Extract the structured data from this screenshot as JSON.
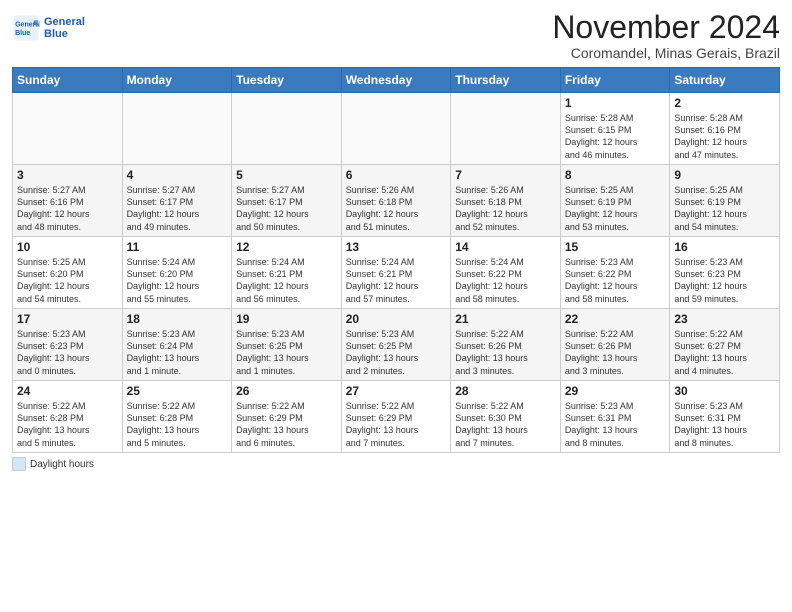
{
  "header": {
    "logo_line1": "General",
    "logo_line2": "Blue",
    "month": "November 2024",
    "location": "Coromandel, Minas Gerais, Brazil"
  },
  "weekdays": [
    "Sunday",
    "Monday",
    "Tuesday",
    "Wednesday",
    "Thursday",
    "Friday",
    "Saturday"
  ],
  "weeks": [
    [
      {
        "day": "",
        "info": ""
      },
      {
        "day": "",
        "info": ""
      },
      {
        "day": "",
        "info": ""
      },
      {
        "day": "",
        "info": ""
      },
      {
        "day": "",
        "info": ""
      },
      {
        "day": "1",
        "info": "Sunrise: 5:28 AM\nSunset: 6:15 PM\nDaylight: 12 hours\nand 46 minutes."
      },
      {
        "day": "2",
        "info": "Sunrise: 5:28 AM\nSunset: 6:16 PM\nDaylight: 12 hours\nand 47 minutes."
      }
    ],
    [
      {
        "day": "3",
        "info": "Sunrise: 5:27 AM\nSunset: 6:16 PM\nDaylight: 12 hours\nand 48 minutes."
      },
      {
        "day": "4",
        "info": "Sunrise: 5:27 AM\nSunset: 6:17 PM\nDaylight: 12 hours\nand 49 minutes."
      },
      {
        "day": "5",
        "info": "Sunrise: 5:27 AM\nSunset: 6:17 PM\nDaylight: 12 hours\nand 50 minutes."
      },
      {
        "day": "6",
        "info": "Sunrise: 5:26 AM\nSunset: 6:18 PM\nDaylight: 12 hours\nand 51 minutes."
      },
      {
        "day": "7",
        "info": "Sunrise: 5:26 AM\nSunset: 6:18 PM\nDaylight: 12 hours\nand 52 minutes."
      },
      {
        "day": "8",
        "info": "Sunrise: 5:25 AM\nSunset: 6:19 PM\nDaylight: 12 hours\nand 53 minutes."
      },
      {
        "day": "9",
        "info": "Sunrise: 5:25 AM\nSunset: 6:19 PM\nDaylight: 12 hours\nand 54 minutes."
      }
    ],
    [
      {
        "day": "10",
        "info": "Sunrise: 5:25 AM\nSunset: 6:20 PM\nDaylight: 12 hours\nand 54 minutes."
      },
      {
        "day": "11",
        "info": "Sunrise: 5:24 AM\nSunset: 6:20 PM\nDaylight: 12 hours\nand 55 minutes."
      },
      {
        "day": "12",
        "info": "Sunrise: 5:24 AM\nSunset: 6:21 PM\nDaylight: 12 hours\nand 56 minutes."
      },
      {
        "day": "13",
        "info": "Sunrise: 5:24 AM\nSunset: 6:21 PM\nDaylight: 12 hours\nand 57 minutes."
      },
      {
        "day": "14",
        "info": "Sunrise: 5:24 AM\nSunset: 6:22 PM\nDaylight: 12 hours\nand 58 minutes."
      },
      {
        "day": "15",
        "info": "Sunrise: 5:23 AM\nSunset: 6:22 PM\nDaylight: 12 hours\nand 58 minutes."
      },
      {
        "day": "16",
        "info": "Sunrise: 5:23 AM\nSunset: 6:23 PM\nDaylight: 12 hours\nand 59 minutes."
      }
    ],
    [
      {
        "day": "17",
        "info": "Sunrise: 5:23 AM\nSunset: 6:23 PM\nDaylight: 13 hours\nand 0 minutes."
      },
      {
        "day": "18",
        "info": "Sunrise: 5:23 AM\nSunset: 6:24 PM\nDaylight: 13 hours\nand 1 minute."
      },
      {
        "day": "19",
        "info": "Sunrise: 5:23 AM\nSunset: 6:25 PM\nDaylight: 13 hours\nand 1 minutes."
      },
      {
        "day": "20",
        "info": "Sunrise: 5:23 AM\nSunset: 6:25 PM\nDaylight: 13 hours\nand 2 minutes."
      },
      {
        "day": "21",
        "info": "Sunrise: 5:22 AM\nSunset: 6:26 PM\nDaylight: 13 hours\nand 3 minutes."
      },
      {
        "day": "22",
        "info": "Sunrise: 5:22 AM\nSunset: 6:26 PM\nDaylight: 13 hours\nand 3 minutes."
      },
      {
        "day": "23",
        "info": "Sunrise: 5:22 AM\nSunset: 6:27 PM\nDaylight: 13 hours\nand 4 minutes."
      }
    ],
    [
      {
        "day": "24",
        "info": "Sunrise: 5:22 AM\nSunset: 6:28 PM\nDaylight: 13 hours\nand 5 minutes."
      },
      {
        "day": "25",
        "info": "Sunrise: 5:22 AM\nSunset: 6:28 PM\nDaylight: 13 hours\nand 5 minutes."
      },
      {
        "day": "26",
        "info": "Sunrise: 5:22 AM\nSunset: 6:29 PM\nDaylight: 13 hours\nand 6 minutes."
      },
      {
        "day": "27",
        "info": "Sunrise: 5:22 AM\nSunset: 6:29 PM\nDaylight: 13 hours\nand 7 minutes."
      },
      {
        "day": "28",
        "info": "Sunrise: 5:22 AM\nSunset: 6:30 PM\nDaylight: 13 hours\nand 7 minutes."
      },
      {
        "day": "29",
        "info": "Sunrise: 5:23 AM\nSunset: 6:31 PM\nDaylight: 13 hours\nand 8 minutes."
      },
      {
        "day": "30",
        "info": "Sunrise: 5:23 AM\nSunset: 6:31 PM\nDaylight: 13 hours\nand 8 minutes."
      }
    ]
  ],
  "footer": {
    "legend_label": "Daylight hours"
  }
}
